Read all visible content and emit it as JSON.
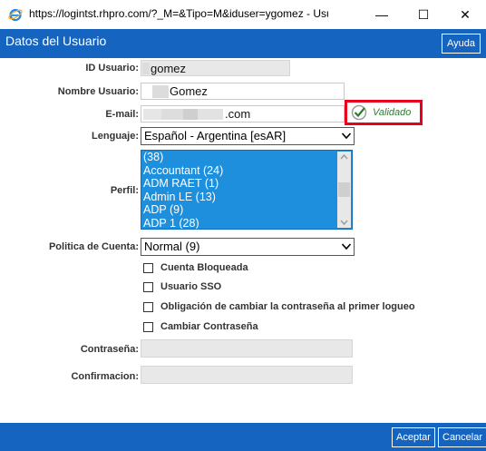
{
  "window": {
    "title": "https://logintst.rhpro.com/?_M=&Tipo=M&iduser=ygomez - Usua...",
    "minimize": "—",
    "maximize": "☐",
    "close": "✕"
  },
  "header": {
    "title": "Datos del Usuario",
    "help_label": "Ayuda"
  },
  "form": {
    "id_label": "ID Usuario:",
    "id_value": "gomez",
    "name_label": "Nombre Usuario:",
    "name_value": "Gomez",
    "email_label": "E-mail:",
    "email_value": ".com",
    "validated_label": "Validado",
    "language_label": "Lenguaje:",
    "language_value": "Español - Argentina [esAR]",
    "profile_label": "Perfil:",
    "profile_items": [
      "(38)",
      "Accountant (24)",
      "ADM RAET (1)",
      "Admin LE (13)",
      "ADP (9)",
      "ADP 1 (28)"
    ],
    "policy_label": "Politica de Cuenta:",
    "policy_value": "Normal (9)",
    "checkboxes": [
      "Cuenta Bloqueada",
      "Usuario SSO",
      "Obligación de cambiar la contraseña al primer logueo",
      "Cambiar Contraseña"
    ],
    "password_label": "Contraseña:",
    "confirm_label": "Confirmacion:"
  },
  "footer": {
    "accept_label": "Aceptar",
    "cancel_label": "Cancelar"
  },
  "colors": {
    "accent": "#1565c0",
    "list_selected": "#1e8fdd",
    "highlight": "#e8001c",
    "valid": "#2e7d32"
  }
}
